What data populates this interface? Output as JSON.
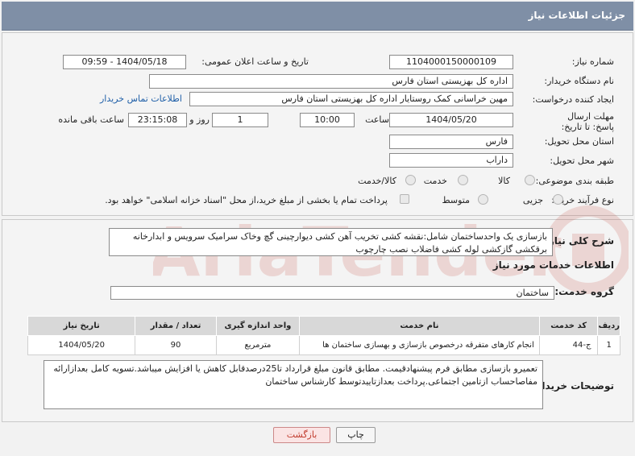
{
  "header": {
    "title": "جزئیات اطلاعات نیاز"
  },
  "form": {
    "need_number_label": "شماره نیاز:",
    "need_number": "1104000150000109",
    "announce_label": "تاریخ و ساعت اعلان عمومی:",
    "announce_value": "1404/05/18 - 09:59",
    "buyer_org_label": "نام دستگاه خریدار:",
    "buyer_org": "اداره کل بهزیستی استان فارس",
    "creator_label": "ایجاد کننده درخواست:",
    "creator": "مهین خراسانی کمک روستایار اداره کل بهزیستی استان فارس",
    "contact_link": "اطلاعات تماس خریدار",
    "deadline_label": "مهلت ارسال پاسخ: تا تاریخ:",
    "deadline_date": "1404/05/20",
    "time_label": "ساعت",
    "deadline_time": "10:00",
    "days_value": "1",
    "days_label": "روز و",
    "remaining_time": "23:15:08",
    "remaining_label": "ساعت باقی مانده",
    "province_label": "استان محل تحویل:",
    "province": "فارس",
    "city_label": "شهر محل تحویل:",
    "city": "داراب",
    "category_label": "طبقه بندی موضوعی:",
    "category_options": [
      "کالا",
      "خدمت",
      "کالا/خدمت"
    ],
    "process_label": "نوع فرآیند خرید :",
    "process_options": [
      "جزیی",
      "متوسط"
    ],
    "payment_note": "پرداخت تمام یا بخشی از مبلغ خرید،از محل \"اسناد خزانه اسلامی\" خواهد بود."
  },
  "description": {
    "label": "شرح کلی نیاز:",
    "text": "بازسازی یک واحدساختمان شامل:نقشه کشی تخریب آهن کشی دیوارچینی گچ وخاک سرامیک سرویس و ابدارخانه برقکشی گازکشی لوله کشی فاضلاب نصب چارچوب"
  },
  "services": {
    "section_title": "اطلاعات خدمات مورد نیاز",
    "group_label": "گروه خدمت:",
    "group_value": "ساختمان",
    "columns": [
      "ردیف",
      "کد خدمت",
      "نام خدمت",
      "واحد اندازه گیری",
      "تعداد / مقدار",
      "تاریخ نیاز"
    ],
    "rows": [
      [
        "1",
        "ج-44",
        "انجام کارهای متفرقه درخصوص بازسازی و بهسازی ساختمان ها",
        "مترمربع",
        "90",
        "1404/05/20"
      ]
    ]
  },
  "buyer_notes": {
    "label": "توضیحات خریدار:",
    "text": "تعمیرو بازسازی مطابق فرم پیشنهادقیمت. مطابق قانون مبلغ قرارداد تا25درصدقابل کاهش یا افزایش میباشد.تسویه کامل بعدازارائه مفاصاحساب ازتامین اجتماعی.پرداخت بعدازتاییدتوسط کارشناس ساختمان"
  },
  "buttons": {
    "print": "چاپ",
    "back": "بازگشت"
  },
  "colors": {
    "header_bg": "#7f8fa6",
    "link": "#1f5fa8",
    "back_text": "#c0392b"
  }
}
